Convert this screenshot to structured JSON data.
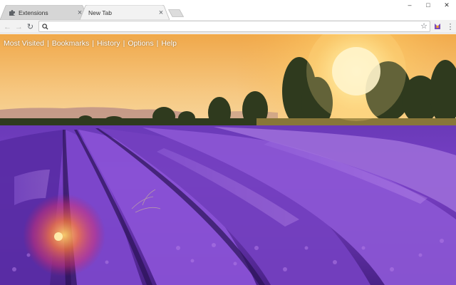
{
  "tabs": [
    {
      "title": "Extensions",
      "icon": "puzzle-icon",
      "active": false
    },
    {
      "title": "New Tab",
      "icon": null,
      "active": true
    }
  ],
  "window_controls": {
    "minimize": "–",
    "maximize": "□",
    "close": "✕"
  },
  "toolbar": {
    "back": "←",
    "forward": "→",
    "reload": "↻",
    "menu": "⋮",
    "star": "☆"
  },
  "omnibox": {
    "value": "",
    "placeholder": ""
  },
  "links": [
    {
      "label": "Most Visited"
    },
    {
      "label": "Bookmarks"
    },
    {
      "label": "History"
    },
    {
      "label": "Options"
    },
    {
      "label": "Help"
    }
  ],
  "link_separator": "|",
  "colors": {
    "sky_top": "#f3b24c",
    "sky_bottom": "#f7d28b",
    "lavender": "#7a3fc4",
    "lavender_dark": "#3d1a78",
    "sun": "#fff3c4"
  }
}
